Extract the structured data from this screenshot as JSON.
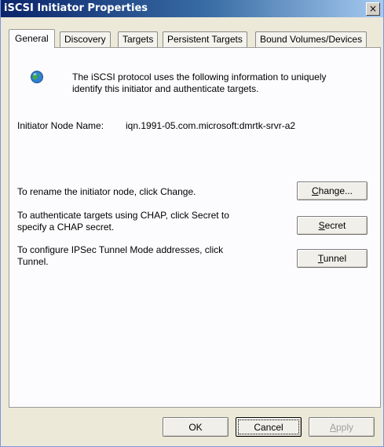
{
  "window": {
    "title": "iSCSI Initiator Properties",
    "close_label": "×"
  },
  "tabs": [
    {
      "label": "General",
      "active": true
    },
    {
      "label": "Discovery"
    },
    {
      "label": "Targets"
    },
    {
      "label": "Persistent Targets"
    },
    {
      "label": "Bound Volumes/Devices"
    }
  ],
  "general": {
    "intro_line1": "The iSCSI protocol uses the following information to uniquely",
    "intro_line2": "identify this initiator and authenticate targets.",
    "node_name_label": "Initiator Node Name:",
    "node_name_value": "iqn.1991-05.com.microsoft:dmrtk-srvr-a2",
    "rename_text": "To rename the initiator node, click Change.",
    "chap_line1": "To authenticate targets using CHAP, click Secret to",
    "chap_line2": "specify a CHAP secret.",
    "ipsec_line1": "To configure IPSec Tunnel Mode addresses, click",
    "ipsec_line2": "Tunnel.",
    "change_button": {
      "mnemonic": "C",
      "rest": "hange..."
    },
    "secret_button": {
      "mnemonic": "S",
      "rest": "ecret"
    },
    "tunnel_button": {
      "mnemonic": "T",
      "rest": "unnel"
    }
  },
  "footer": {
    "ok": "OK",
    "cancel": "Cancel",
    "apply": {
      "mnemonic": "A",
      "rest": "pply"
    }
  },
  "colors": {
    "title_gradient_start": "#0a246a",
    "title_gradient_end": "#a6caf0",
    "dialog_background": "#ece9d8",
    "panel_background": "#fcfcfe",
    "disabled_text": "#a0a0a0"
  }
}
